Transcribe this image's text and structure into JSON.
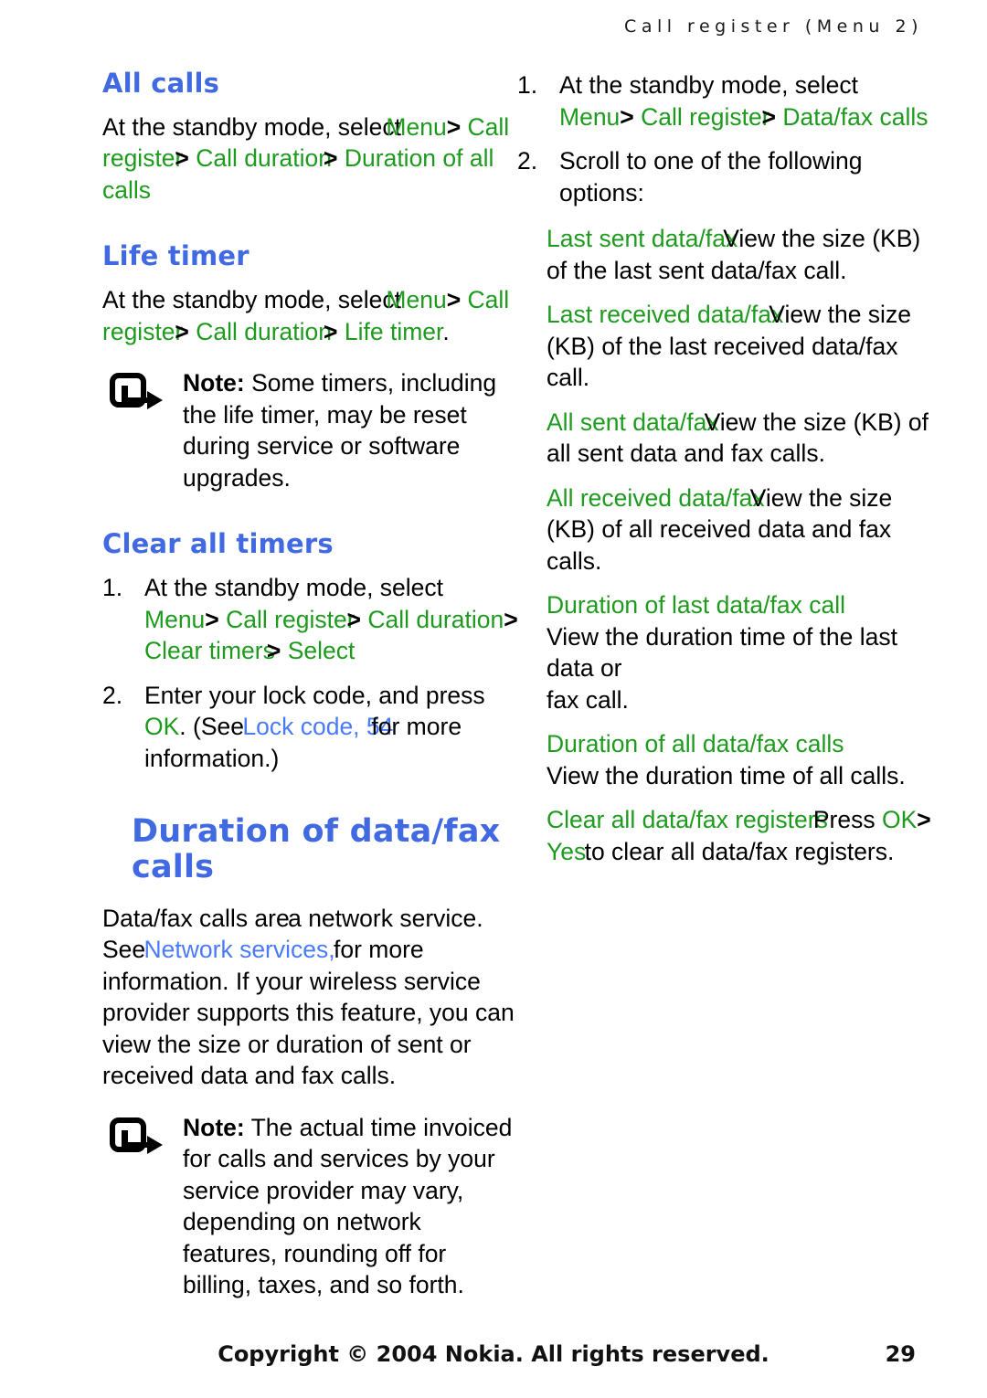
{
  "header": {
    "running_head": "Call register (Menu 2)"
  },
  "footer": {
    "copyright": "Copyright © 2004 Nokia. All rights reserved.",
    "page_number": "29"
  },
  "left_column": {
    "all_calls": {
      "heading": "All calls",
      "intro_plain": "At the standby mode, select ",
      "path_menu": "Menu",
      "arrow": ">",
      "path_call_register": "Call register",
      "path_call_duration": "Call duration",
      "path_duration_of_all_calls": "Duration of all calls"
    },
    "life_timer": {
      "heading": "Life timer",
      "intro_plain": "At the standby mode, select ",
      "path_menu": "Menu",
      "arrow": ">",
      "path_call_register": "Call register",
      "path_call_duration": "Call duration",
      "path_life_timer": "Life timer",
      "period": ".",
      "note": {
        "icon": "note-arrow-icon",
        "label": "Note:",
        "text": " Some timers, including the life timer, may be reset during service or software upgrades."
      }
    },
    "clear_all_timers": {
      "heading": "Clear all timers",
      "steps": [
        {
          "num": "1.",
          "plain": "At the standby mode, select ",
          "path_menu": "Menu",
          "arrow": ">",
          "path_call_register": "Call register",
          "path_call_duration": "Call duration",
          "path_clear_timers": "Clear timers",
          "path_select": "Select"
        },
        {
          "num": "2.",
          "plain_before": "Enter your lock code, and press ",
          "ok": "OK",
          "paren_see": ". (See ",
          "xref": "Lock code, 54",
          "plain_after": "for more information.)"
        }
      ]
    },
    "duration_of_data_fax_calls": {
      "heading_line1": "Duration of data/fax",
      "heading_line2": "calls",
      "para1_a": "Data/fax calls are",
      "para1_b": " a network service. See ",
      "para1_xref": "Network services,",
      "para1_c": " for more information. If your wireless service provider supports this feature, you can view the size or duration of sent or received data and fax calls.",
      "note": {
        "icon": "note-arrow-icon",
        "label": "Note:",
        "text": " The actual time invoiced for calls and services by your service provider may vary, depending on network features, rounding off for billing, taxes, and so forth."
      }
    }
  },
  "right_column": {
    "steps": [
      {
        "num": "1.",
        "plain": "At the standby mode, select ",
        "path_menu": "Menu",
        "arrow": ">",
        "path_call_register": "Call register",
        "path_data_fax_calls": "Data/fax calls"
      },
      {
        "num": "2.",
        "plain": "Scroll to one of the following options:"
      }
    ],
    "options": [
      {
        "name": "Last sent data/fax",
        "description": "View the size (KB) of the last sent data/fax call."
      },
      {
        "name": "Last received data/fax",
        "description": "View the size (KB) of the last received data/fax call."
      },
      {
        "name": "All sent data/fax",
        "description": "View the size (KB) of all sent data and fax calls."
      },
      {
        "name": "All received data/fax",
        "description": "View the size (KB) of all received data and fax calls."
      }
    ],
    "duration_last": {
      "name": "Duration of last data/fax call",
      "description_line1": "View the duration time of the last data or",
      "description_line2": "fax call."
    },
    "duration_all": {
      "name": "Duration of all data/fax calls",
      "description": "View the duration time of all calls."
    },
    "clear_all_registers": {
      "name": "Clear all data/fax registers",
      "press": "Press ",
      "ok": "OK",
      "arrow": ">",
      "yes": "Yes",
      "tail": " to clear all data/fax registers."
    }
  }
}
